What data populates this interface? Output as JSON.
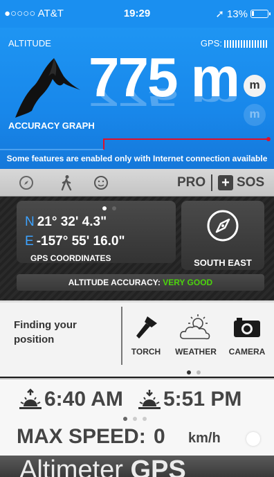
{
  "status": {
    "carrier": "●○○○○ AT&T",
    "time": "19:29",
    "location_arrow": "➚",
    "battery": "13%",
    "battery_level": 0.13
  },
  "altitude": {
    "label": "ALTITUDE",
    "gps_label": "GPS:",
    "value": "775 m",
    "unit_button": "m",
    "graph_title": "ACCURACY GRAPH",
    "notice": "Some features are enabled only with Internet connection available"
  },
  "toolbar": {
    "pro": "PRO",
    "plus": "+",
    "sos": "SOS"
  },
  "coordinates": {
    "north_dir": "N",
    "north": "21° 32' 4.3\"",
    "east_dir": "E",
    "east": "-157° 55' 16.0\"",
    "label": "GPS COORDINATES",
    "compass_label": "SOUTH EAST",
    "accuracy_label": "ALTITUDE ACCURACY:",
    "accuracy_value": "VERY GOOD"
  },
  "tools": {
    "status": "Finding your position",
    "items": [
      {
        "label": "TORCH"
      },
      {
        "label": "WEATHER"
      },
      {
        "label": "CAMERA"
      }
    ]
  },
  "sun": {
    "sunrise": "6:40 AM",
    "sunset": "5:51 PM"
  },
  "speed": {
    "label": "MAX SPEED:",
    "value": "0",
    "unit": "km/h"
  },
  "footer": {
    "brand_light": "Altimeter ",
    "brand_bold": "GPS"
  },
  "colors": {
    "primary_blue": "#1a8ff0",
    "accent_good": "#4cd40c",
    "graph_line": "#e0102a"
  }
}
